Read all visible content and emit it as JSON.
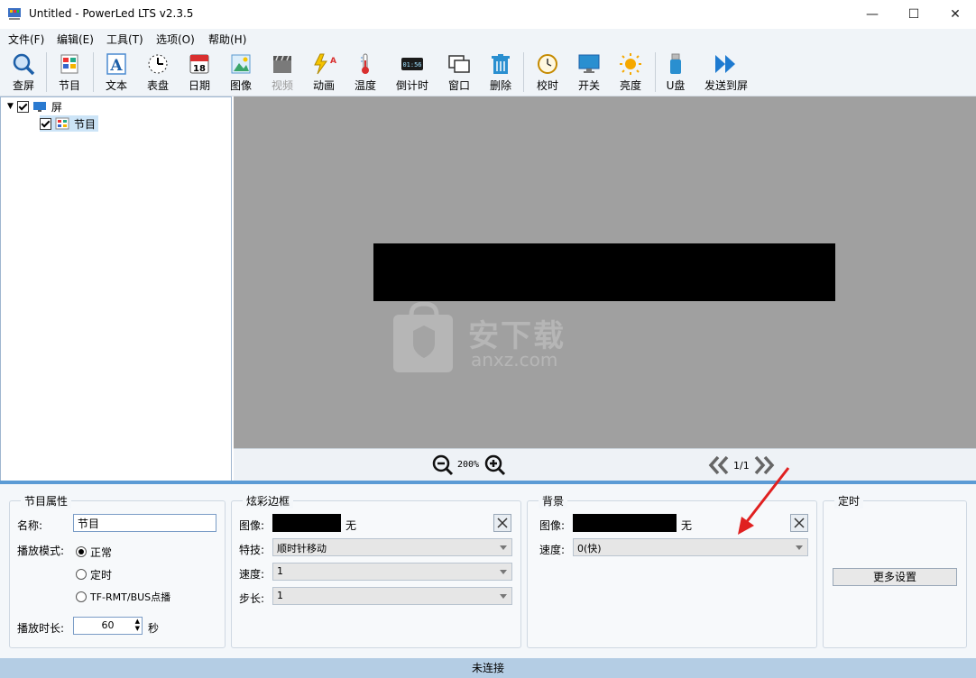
{
  "window": {
    "title": "Untitled - PowerLed LTS v2.3.5",
    "minimize": "—",
    "maximize": "☐",
    "close": "✕"
  },
  "menu": [
    "文件(F)",
    "编辑(E)",
    "工具(T)",
    "选项(O)",
    "帮助(H)"
  ],
  "toolbar": {
    "search": "查屏",
    "program": "节目",
    "text": "文本",
    "clock": "表盘",
    "date": "日期",
    "image": "图像",
    "video": "视频",
    "anim": "动画",
    "temp": "温度",
    "countdown": "倒计时",
    "window": "窗口",
    "delete": "删除",
    "timecal": "校时",
    "power": "开关",
    "brightness": "亮度",
    "udisk": "U盘",
    "send": "发送到屏"
  },
  "tree": {
    "screen": "屏",
    "program": "节目"
  },
  "preview": {
    "watermark": "安下载",
    "watermark_sub": "anxz.com"
  },
  "zoom": {
    "level": "200%",
    "page": "1/1"
  },
  "program_props": {
    "title": "节目属性",
    "name_label": "名称:",
    "name_value": "节目",
    "mode_label": "播放模式:",
    "mode_normal": "正常",
    "mode_timed": "定时",
    "mode_bus": "TF-RMT/BUS点播",
    "duration_label": "播放时长:",
    "duration_value": "60",
    "duration_unit": "秒"
  },
  "border": {
    "title": "炫彩边框",
    "image_label": "图像:",
    "image_none": "无",
    "effect_label": "特技:",
    "effect_value": "顺时针移动",
    "speed_label": "速度:",
    "speed_value": "1",
    "step_label": "步长:",
    "step_value": "1"
  },
  "background": {
    "title": "背景",
    "image_label": "图像:",
    "image_none": "无",
    "speed_label": "速度:",
    "speed_value": "0(快)"
  },
  "timing": {
    "title": "定时",
    "more_button": "更多设置"
  },
  "status": "未连接"
}
